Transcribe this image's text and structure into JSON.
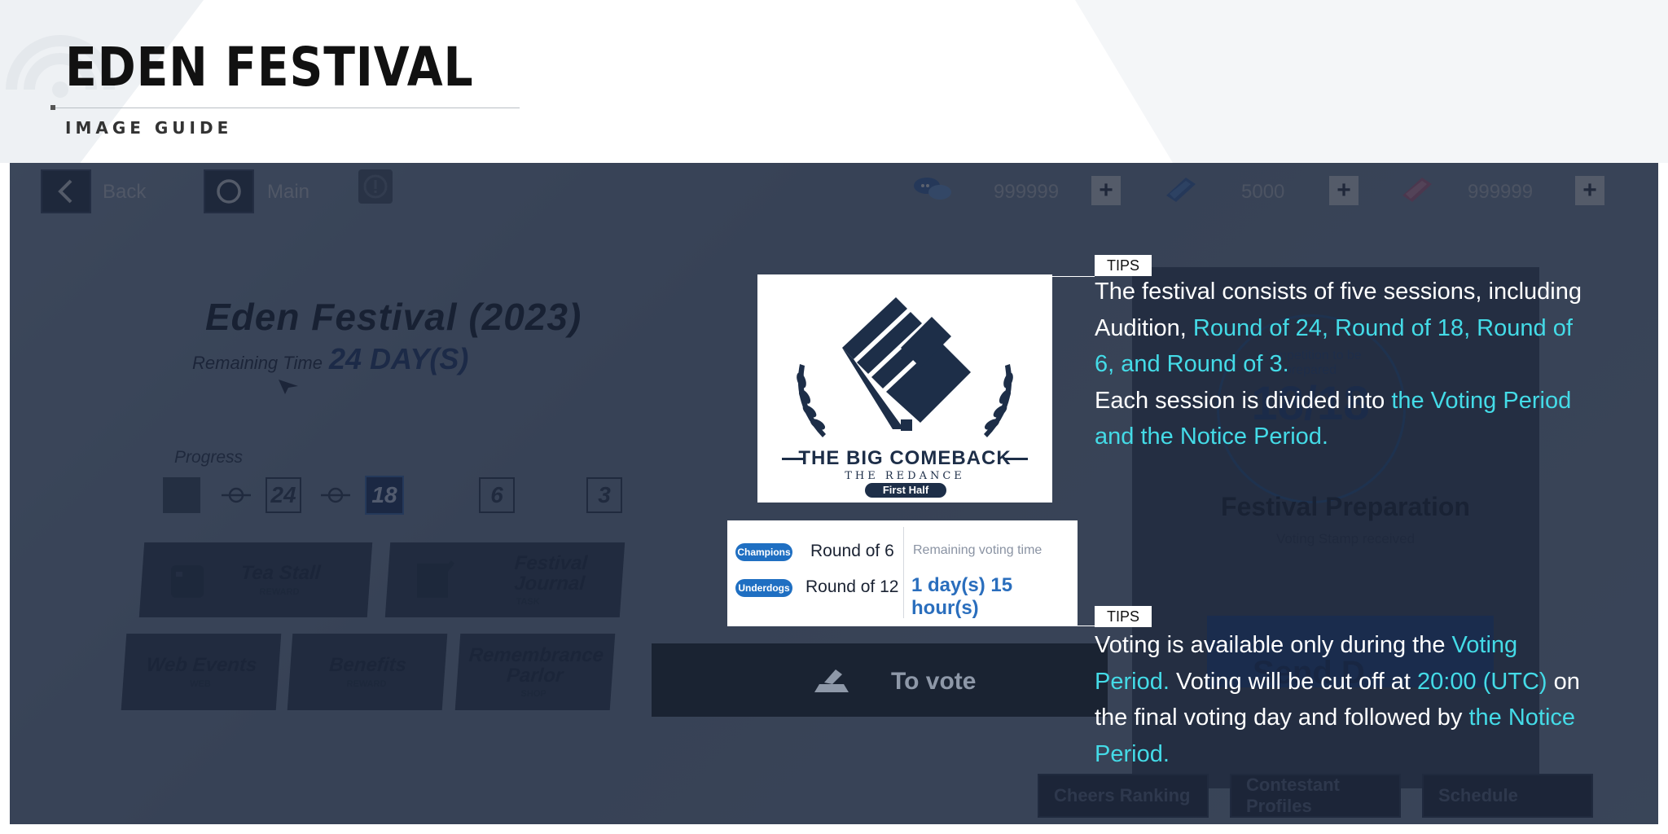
{
  "header": {
    "title": "EDEN FESTIVAL",
    "subtitle": "IMAGE GUIDE"
  },
  "topbar": {
    "back_label": "Back",
    "main_label": "Main",
    "resources": [
      {
        "icon": "chat-bubbles-icon",
        "value": "999999"
      },
      {
        "icon": "ticket-icon",
        "value": "5000"
      },
      {
        "icon": "pink-ticket-icon",
        "value": "999999"
      }
    ]
  },
  "left_panel": {
    "festival_name": "Eden Festival (2023)",
    "remaining_label": "Remaining Time",
    "remaining_value": "24 DAY(S)",
    "progress_label": "Progress",
    "progress_steps": [
      "24",
      "18",
      "6",
      "3"
    ],
    "active_step": "18",
    "menu": [
      {
        "title": "Tea Stall",
        "sub": "REWARD"
      },
      {
        "title": "Festival Journal",
        "sub": "TASK"
      },
      {
        "title": "Web Events",
        "sub": "WEB"
      },
      {
        "title": "Benefits",
        "sub": "REWARD"
      },
      {
        "title": "Remembrance Parlor",
        "sub": "SHOP"
      }
    ]
  },
  "right_panel": {
    "circle_small": "Competition to be prepared",
    "circle_big": "18/18",
    "prep_title": "Festival Preparation",
    "prep_sub": "Voting Stamp received",
    "send_label": "Send D",
    "buttons": [
      "Cheers Ranking",
      "Contestant Profiles",
      "Schedule"
    ]
  },
  "logo_card": {
    "title": "THE BIG COMEBACK",
    "subtitle": "THE REDANCE",
    "badge": "First Half"
  },
  "vote_card": {
    "rows": [
      {
        "pill": "Champions",
        "round": "Round of 6"
      },
      {
        "pill": "Underdogs",
        "round": "Round of 12"
      }
    ],
    "remaining_label": "Remaining voting time",
    "remaining_value": "1 day(s) 15 hour(s)"
  },
  "to_vote_label": "To vote",
  "tips": [
    {
      "tag": "TIPS",
      "segments": [
        {
          "t": "The festival consists of five sessions, including Audition, ",
          "h": false
        },
        {
          "t": "Round of 24, Round of 18, Round of 6, and Round of 3.",
          "h": true
        },
        {
          "t": "\nEach session is divided into ",
          "h": false
        },
        {
          "t": "the Voting Period and the Notice Period.",
          "h": true
        }
      ]
    },
    {
      "tag": "TIPS",
      "segments": [
        {
          "t": "Voting is available only during the ",
          "h": false
        },
        {
          "t": "Voting Period.",
          "h": true
        },
        {
          "t": " Voting will be cut off at ",
          "h": false
        },
        {
          "t": "20:00 (UTC)",
          "h": true
        },
        {
          "t": " on the final voting day and followed by ",
          "h": false
        },
        {
          "t": "the Notice Period.",
          "h": true
        }
      ]
    }
  ],
  "colors": {
    "highlight": "#44dbe7",
    "tips_text": "#ffffff",
    "pill": "#1f6fc2",
    "active_step": "#1b3466"
  }
}
